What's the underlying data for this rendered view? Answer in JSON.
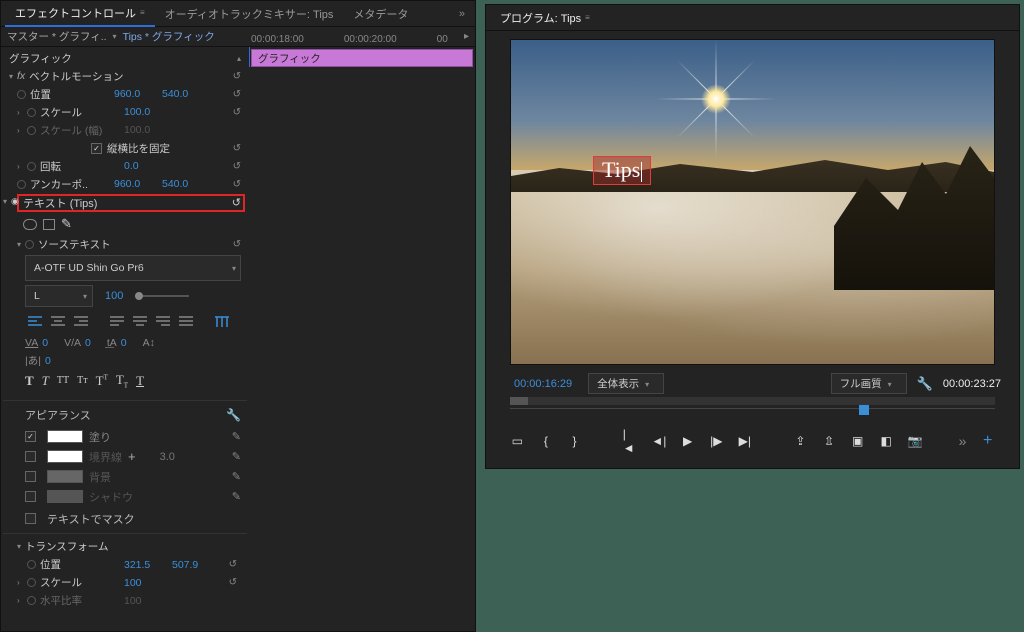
{
  "tabs": {
    "effect": "エフェクトコントロール",
    "mixer": "オーディオトラックミキサー: Tips",
    "meta": "メタデータ"
  },
  "source": {
    "master": "マスター * グラフィ..",
    "seq": "Tips * グラフィック"
  },
  "timeHeader": {
    "t1": "00:00:18:00",
    "t2": "00:00:20:00",
    "t3": "00"
  },
  "clipName": "グラフィック",
  "rootGroup": "グラフィック",
  "vector": {
    "title": "ベクトルモーション",
    "position": {
      "label": "位置",
      "x": "960.0",
      "y": "540.0"
    },
    "scale": {
      "label": "スケール",
      "v": "100.0"
    },
    "scaleW": {
      "label": "スケール (幅)",
      "v": "100.0"
    },
    "uniform": "縦横比を固定",
    "rotation": {
      "label": "回転",
      "v": "0.0"
    },
    "anchor": {
      "label": "アンカーポ..",
      "x": "960.0",
      "y": "540.0"
    }
  },
  "textLayer": "テキスト (Tips)",
  "sourceText": "ソーステキスト",
  "font": {
    "name": "A-OTF UD Shin Go Pr6",
    "style": "L",
    "size": "100"
  },
  "kerning": {
    "va1": "0",
    "va2": "0",
    "ta": "0"
  },
  "appearance": {
    "title": "アピアランス",
    "fill": {
      "label": "塗り",
      "on": true,
      "color": "#ffffff"
    },
    "stroke": {
      "label": "境界線",
      "on": false,
      "color": "#ffffff",
      "w": "3.0"
    },
    "bg": {
      "label": "背景",
      "on": false,
      "color": "#666666"
    },
    "shadow": {
      "label": "シャドウ",
      "on": false,
      "color": "#555555"
    },
    "mask": "テキストでマスク"
  },
  "transform": {
    "title": "トランスフォーム",
    "position": {
      "label": "位置",
      "x": "321.5",
      "y": "507.9"
    },
    "scale": {
      "label": "スケール",
      "v": "100"
    },
    "scaleH": {
      "label": "水平比率",
      "v": "100"
    }
  },
  "program": {
    "title": "プログラム: Tips",
    "overlayText": "Tips",
    "tcIn": "00:00:16:29",
    "fit": "全体表示",
    "res": "フル画質",
    "tcOut": "00:00:23:27"
  }
}
